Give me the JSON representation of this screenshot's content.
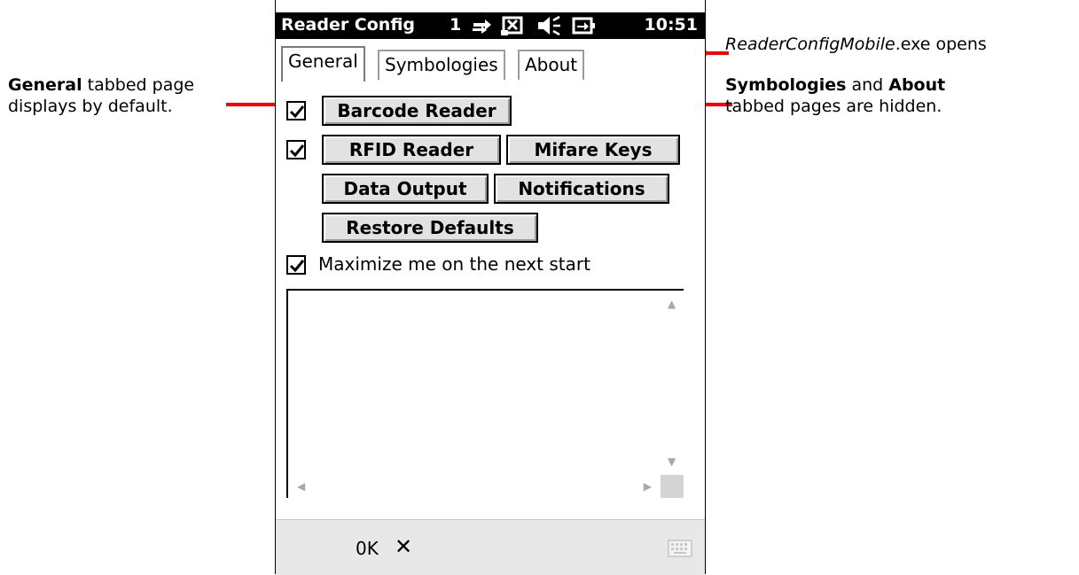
{
  "annotations": {
    "general_bold": "General",
    "general_rest_line1": " tabbed page",
    "general_line2": "displays by default.",
    "hidden_bold1": "Symbologies",
    "hidden_and": " and ",
    "hidden_bold2": "About",
    "hidden_line2": "tabbed pages are hidden.",
    "opens_italic": "ReaderConfigMobile",
    "opens_rest": ".exe opens"
  },
  "statusbar": {
    "title": "Reader Config",
    "signal": "1",
    "time": "10:51",
    "icons": [
      "sync-icon",
      "connection-icon",
      "volume-icon",
      "battery-charging-icon"
    ]
  },
  "tabs": [
    {
      "label": "General",
      "active": true
    },
    {
      "label": "Symbologies",
      "active": false
    },
    {
      "label": "About",
      "active": false
    }
  ],
  "general": {
    "barcode_reader": {
      "label": "Barcode Reader",
      "checked": true
    },
    "rfid_reader": {
      "label": "RFID Reader",
      "checked": true
    },
    "mifare_keys": "Mifare Keys",
    "data_output": "Data Output",
    "notifications": "Notifications",
    "restore_defaults": "Restore Defaults",
    "maximize": {
      "label": "Maximize me on the next start",
      "checked": true
    },
    "output_text": ""
  },
  "menubar": {
    "ok": "0K",
    "close": "✕",
    "keyboard": "keyboard-icon"
  },
  "colors": {
    "callout": "#ff0000",
    "statusbar_bg": "#000000",
    "menubar_bg": "#e8e8e8",
    "button_bg": "#e2e2e2"
  }
}
